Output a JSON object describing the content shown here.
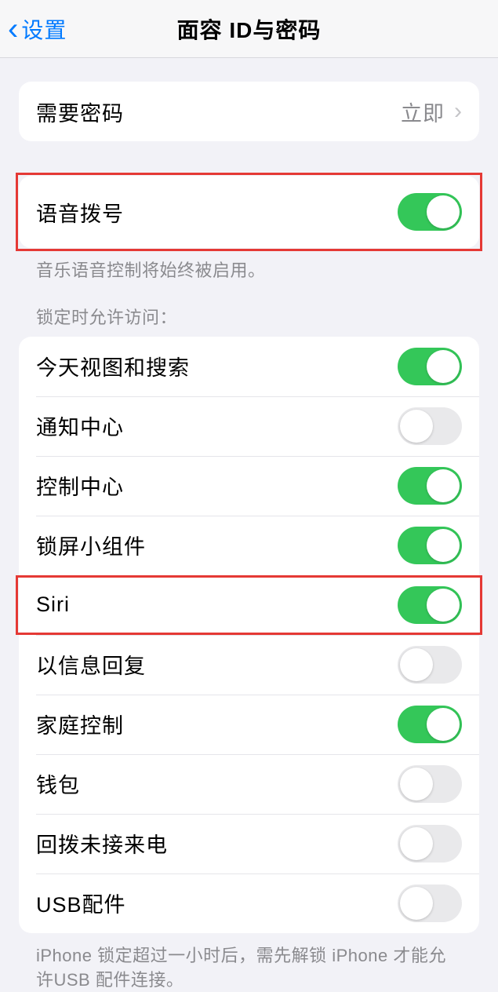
{
  "navbar": {
    "back_label": "设置",
    "title": "面容 ID与密码"
  },
  "passcode_group": {
    "require_passcode_label": "需要密码",
    "require_passcode_value": "立即"
  },
  "voice_group": {
    "voice_dial_label": "语音拨号",
    "voice_dial_on": true,
    "footer": "音乐语音控制将始终被启用。"
  },
  "allow_access": {
    "header": "锁定时允许访问：",
    "items": [
      {
        "label": "今天视图和搜索",
        "on": true
      },
      {
        "label": "通知中心",
        "on": false
      },
      {
        "label": "控制中心",
        "on": true
      },
      {
        "label": "锁屏小组件",
        "on": true
      },
      {
        "label": "Siri",
        "on": true,
        "highlight": true
      },
      {
        "label": "以信息回复",
        "on": false
      },
      {
        "label": "家庭控制",
        "on": true
      },
      {
        "label": "钱包",
        "on": false
      },
      {
        "label": "回拨未接来电",
        "on": false
      },
      {
        "label": "USB配件",
        "on": false
      }
    ],
    "footer": "iPhone 锁定超过一小时后，需先解锁 iPhone 才能允许USB 配件连接。"
  }
}
